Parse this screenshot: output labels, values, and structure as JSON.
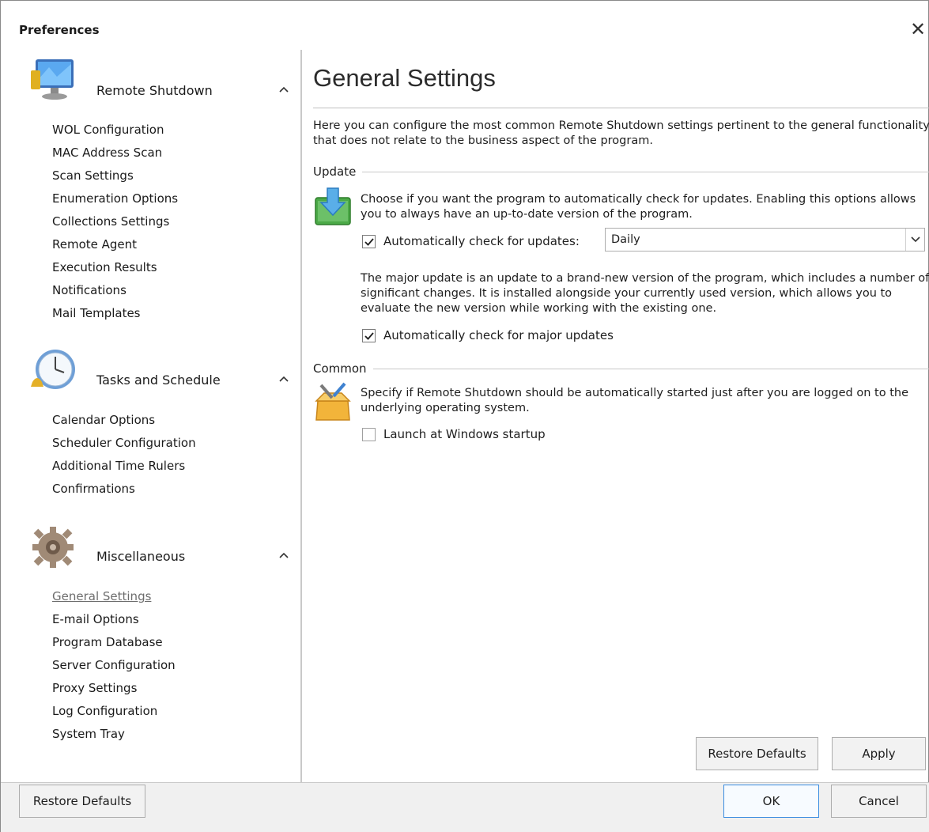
{
  "window": {
    "title": "Preferences",
    "close_glyph": "✕"
  },
  "sidebar": {
    "groups": [
      {
        "label": "Remote Shutdown",
        "icon": "monitor-icon",
        "items": [
          "WOL Configuration",
          "MAC Address Scan",
          "Scan Settings",
          "Enumeration Options",
          "Collections Settings",
          "Remote Agent",
          "Execution Results",
          "Notifications",
          "Mail Templates"
        ]
      },
      {
        "label": "Tasks and Schedule",
        "icon": "clock-icon",
        "items": [
          "Calendar Options",
          "Scheduler Configuration",
          "Additional Time Rulers",
          "Confirmations"
        ]
      },
      {
        "label": "Miscellaneous",
        "icon": "gear-icon",
        "items": [
          "General Settings",
          "E-mail Options",
          "Program Database",
          "Server Configuration",
          "Proxy Settings",
          "Log Configuration",
          "System Tray"
        ]
      }
    ],
    "active_item": "General Settings"
  },
  "content": {
    "title": "General Settings",
    "intro": "Here you can configure the most common Remote Shutdown settings pertinent to the general functionality that does not relate to the business aspect of the program.",
    "update": {
      "label": "Update",
      "description": "Choose if you want the program to automatically check for updates. Enabling this options allows you to always have an up-to-date version of the program.",
      "auto_check_label": "Automatically check for updates:",
      "auto_check_checked": true,
      "frequency_value": "Daily",
      "major_description": "The major update is an update to a brand-new version of the program, which includes a number of significant changes. It is installed alongside your currently used version, which allows you to evaluate the new version while working with the existing one.",
      "major_check_label": "Automatically check for major updates",
      "major_check_checked": true
    },
    "common": {
      "label": "Common",
      "description": "Specify if Remote Shutdown should be automatically started just after you are logged on to the underlying operating system.",
      "startup_label": "Launch at Windows startup",
      "startup_checked": false
    },
    "buttons": {
      "restore_defaults": "Restore Defaults",
      "apply": "Apply"
    }
  },
  "footer": {
    "restore_defaults": "Restore Defaults",
    "ok": "OK",
    "cancel": "Cancel"
  },
  "colors": {
    "accent": "#3b8de0",
    "divider": "#c9c9c9",
    "footer_bg": "#f0f0f0"
  }
}
